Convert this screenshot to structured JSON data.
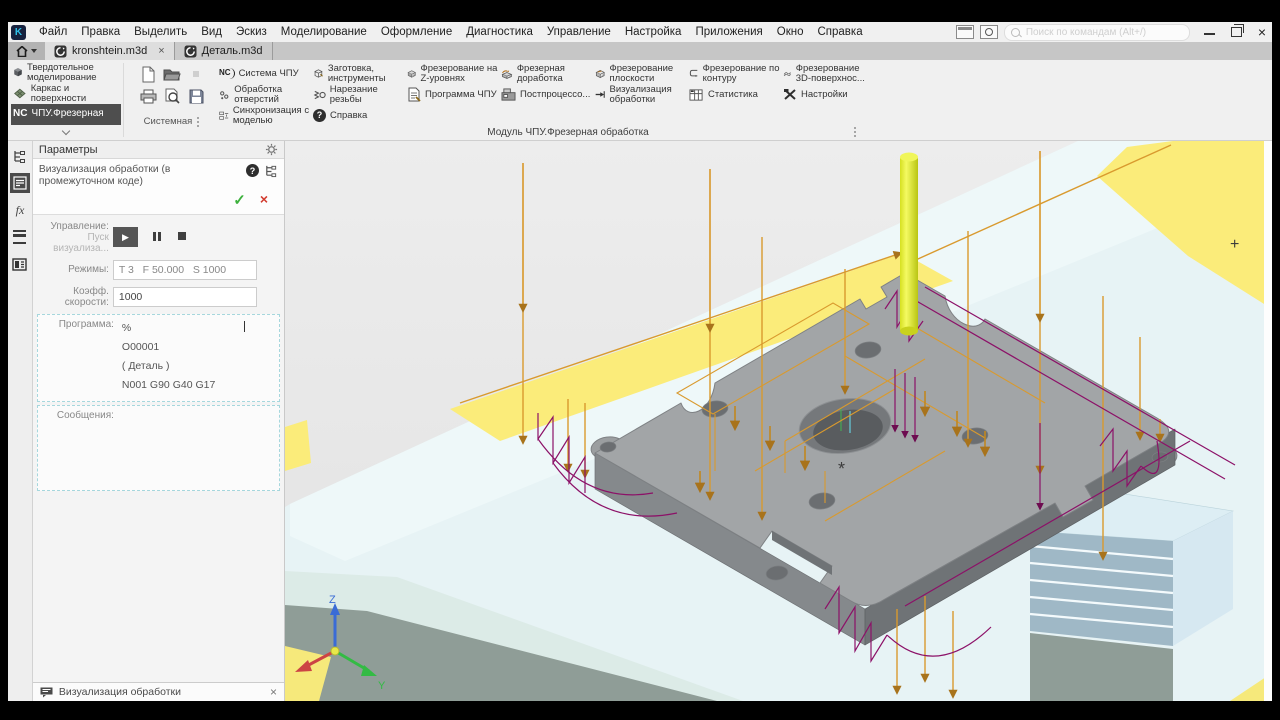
{
  "window": {
    "app_letter": "K",
    "search_placeholder": "Поиск по командам (Alt+/)"
  },
  "menu": {
    "items": [
      "Файл",
      "Правка",
      "Выделить",
      "Вид",
      "Эскиз",
      "Моделирование",
      "Оформление",
      "Диагностика",
      "Управление",
      "Настройка",
      "Приложения",
      "Окно",
      "Справка"
    ]
  },
  "tabs": {
    "items": [
      {
        "label": "kronshtein.m3d",
        "close": "×"
      },
      {
        "label": "Деталь.m3d"
      }
    ]
  },
  "workspace": {
    "items": [
      {
        "label": "Твердотельное моделирование"
      },
      {
        "label": "Каркас и поверхности"
      },
      {
        "badge": "NC",
        "label": "ЧПУ.Фрезерная"
      }
    ]
  },
  "toolbar": {
    "system_label": "Системная",
    "module_label": "Модуль ЧПУ.Фрезерная обработка",
    "nc_icon_text": "NC",
    "help_glyph": "?",
    "cols": [
      {
        "items": [
          {
            "label": "Система ЧПУ"
          },
          {
            "label": "Обработка отверстий"
          },
          {
            "label": "Синхронизация с моделью"
          }
        ]
      },
      {
        "items": [
          {
            "label": "Заготовка, инструменты"
          },
          {
            "label": "Нарезание резьбы"
          },
          {
            "label": "Справка"
          }
        ]
      },
      {
        "items": [
          {
            "label": "Фрезерование на Z-уровнях"
          },
          {
            "label": "Программа ЧПУ"
          }
        ]
      },
      {
        "items": [
          {
            "label": "Фрезерная доработка"
          },
          {
            "label": "Постпроцессо..."
          }
        ]
      },
      {
        "items": [
          {
            "label": "Фрезерование плоскости"
          },
          {
            "label": "Визуализация обработки"
          }
        ]
      },
      {
        "items": [
          {
            "label": "Фрезерование по контуру"
          },
          {
            "label": "Статистика"
          }
        ]
      },
      {
        "items": [
          {
            "label": "Фрезерование 3D-поверхнос..."
          },
          {
            "label": "Настройки"
          }
        ]
      }
    ]
  },
  "panel": {
    "title": "Параметры",
    "command_title": "Визуализация обработки (в промежуточном коде)",
    "help_glyph": "?",
    "ok_glyph": "✓",
    "cancel_glyph": "×",
    "management_label": "Управление:",
    "management_sub": "Пуск визуализа...",
    "play_glyph": "▶",
    "modes_label": "Режимы:",
    "modes_value": "T 3   F 50.000   S 1000",
    "speed_label": "Коэфф. скорости:",
    "speed_value": "1000",
    "program_label": "Программа:",
    "program_lines": [
      "%",
      "O00001",
      "( Деталь )",
      "N001 G90 G40 G17"
    ],
    "messages_label": "Сообщения:",
    "bottom_tab_label": "Визуализация обработки"
  },
  "viewport": {
    "axis_z": "Z",
    "axis_y": "Y",
    "cursor_marker": "+",
    "origin_marker": "*"
  },
  "colors": {
    "toolpath_orange": "#d99a2e",
    "toolpath_purple": "#8c1168",
    "tool_yellow": "#e8f23c",
    "stock_yellow": "#fbec7a",
    "fixture_cyan": "#e7f3f5",
    "table_green": "#8f9d97",
    "check_green": "#3db13d",
    "cross_red": "#d23b2f"
  }
}
